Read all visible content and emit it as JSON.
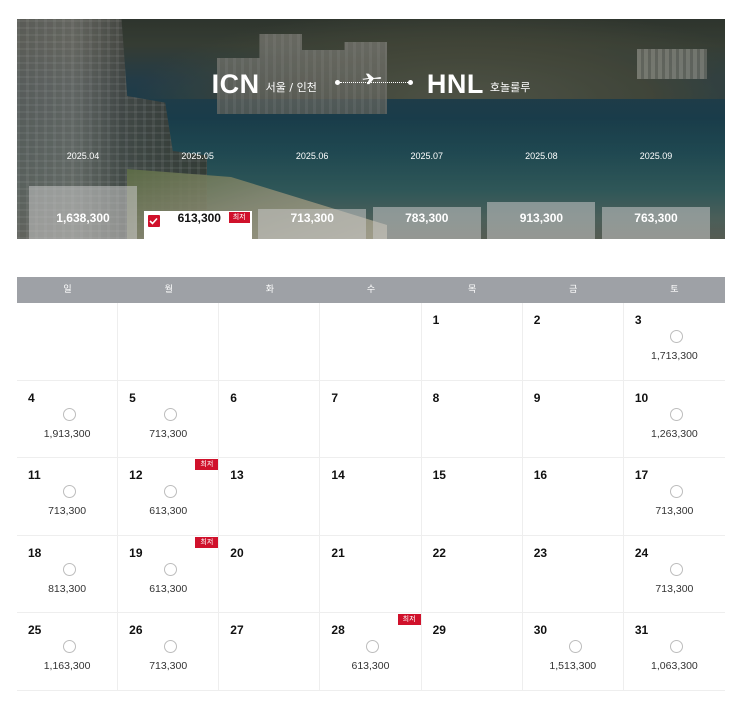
{
  "route": {
    "origin_code": "ICN",
    "origin_city": "서울 / 인천",
    "destination_code": "HNL",
    "destination_city": "호놀룰루"
  },
  "months": [
    {
      "label": "2025.04",
      "price": "1,638,300",
      "level": 0.62,
      "selected": false,
      "lowest": false
    },
    {
      "label": "2025.05",
      "price": "613,300",
      "level": 0.24,
      "selected": true,
      "lowest": true
    },
    {
      "label": "2025.06",
      "price": "713,300",
      "level": 0.28,
      "selected": false,
      "lowest": false
    },
    {
      "label": "2025.07",
      "price": "783,300",
      "level": 0.32,
      "selected": false,
      "lowest": false
    },
    {
      "label": "2025.08",
      "price": "913,300",
      "level": 0.38,
      "selected": false,
      "lowest": false
    },
    {
      "label": "2025.09",
      "price": "763,300",
      "level": 0.31,
      "selected": false,
      "lowest": false
    }
  ],
  "lowest_label": "최저",
  "weekdays": [
    "일",
    "월",
    "화",
    "수",
    "목",
    "금",
    "토"
  ],
  "days": [
    {
      "day": "",
      "fare": ""
    },
    {
      "day": "",
      "fare": ""
    },
    {
      "day": "",
      "fare": ""
    },
    {
      "day": "",
      "fare": ""
    },
    {
      "day": "1",
      "fare": ""
    },
    {
      "day": "2",
      "fare": ""
    },
    {
      "day": "3",
      "fare": "1,713,300"
    },
    {
      "day": "4",
      "fare": "1,913,300"
    },
    {
      "day": "5",
      "fare": "713,300"
    },
    {
      "day": "6",
      "fare": ""
    },
    {
      "day": "7",
      "fare": ""
    },
    {
      "day": "8",
      "fare": ""
    },
    {
      "day": "9",
      "fare": ""
    },
    {
      "day": "10",
      "fare": "1,263,300"
    },
    {
      "day": "11",
      "fare": "713,300"
    },
    {
      "day": "12",
      "fare": "613,300",
      "lowest": true
    },
    {
      "day": "13",
      "fare": ""
    },
    {
      "day": "14",
      "fare": ""
    },
    {
      "day": "15",
      "fare": ""
    },
    {
      "day": "16",
      "fare": ""
    },
    {
      "day": "17",
      "fare": "713,300"
    },
    {
      "day": "18",
      "fare": "813,300"
    },
    {
      "day": "19",
      "fare": "613,300",
      "lowest": true
    },
    {
      "day": "20",
      "fare": ""
    },
    {
      "day": "21",
      "fare": ""
    },
    {
      "day": "22",
      "fare": ""
    },
    {
      "day": "23",
      "fare": ""
    },
    {
      "day": "24",
      "fare": "713,300"
    },
    {
      "day": "25",
      "fare": "1,163,300"
    },
    {
      "day": "26",
      "fare": "713,300"
    },
    {
      "day": "27",
      "fare": ""
    },
    {
      "day": "28",
      "fare": "613,300",
      "lowest": true
    },
    {
      "day": "29",
      "fare": ""
    },
    {
      "day": "30",
      "fare": "1,513,300"
    },
    {
      "day": "31",
      "fare": "1,063,300"
    }
  ],
  "colors": {
    "accent": "#d0112b",
    "header_gray": "#9ea1a6"
  }
}
